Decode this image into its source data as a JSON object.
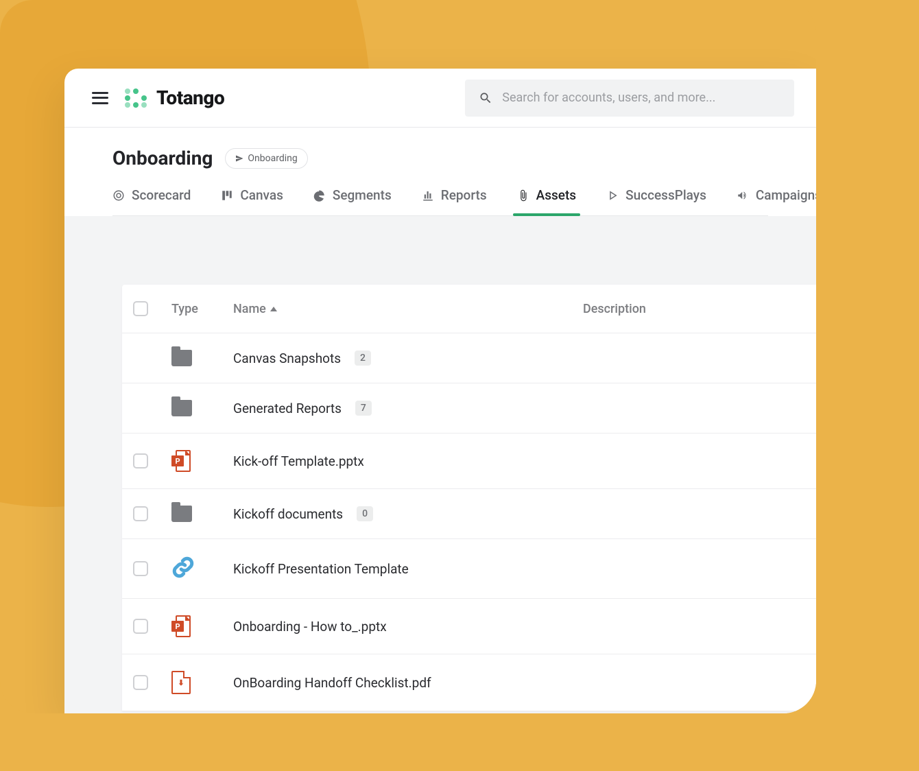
{
  "brand": {
    "name": "Totango"
  },
  "search": {
    "placeholder": "Search for accounts, users, and more..."
  },
  "page": {
    "title": "Onboarding",
    "chip": "Onboarding"
  },
  "tabs": [
    {
      "label": "Scorecard",
      "icon": "target-icon"
    },
    {
      "label": "Canvas",
      "icon": "kanban-icon"
    },
    {
      "label": "Segments",
      "icon": "pie-icon"
    },
    {
      "label": "Reports",
      "icon": "bar-chart-icon"
    },
    {
      "label": "Assets",
      "icon": "paperclip-icon",
      "active": true
    },
    {
      "label": "SuccessPlays",
      "icon": "play-icon"
    },
    {
      "label": "Campaigns",
      "icon": "megaphone-icon"
    }
  ],
  "table": {
    "columns": {
      "type": "Type",
      "name": "Name",
      "description": "Description"
    },
    "rows": [
      {
        "type": "folder",
        "name": "Canvas Snapshots",
        "count": "2",
        "checkbox": false
      },
      {
        "type": "folder",
        "name": "Generated Reports",
        "count": "7",
        "checkbox": false
      },
      {
        "type": "ppt",
        "name": "Kick-off Template.pptx",
        "checkbox": true
      },
      {
        "type": "folder",
        "name": "Kickoff documents",
        "count": "0",
        "checkbox": true
      },
      {
        "type": "link",
        "name": "Kickoff Presentation Template",
        "checkbox": true
      },
      {
        "type": "ppt",
        "name": "Onboarding - How to_.pptx",
        "checkbox": true
      },
      {
        "type": "pdf",
        "name": "OnBoarding Handoff Checklist.pdf",
        "checkbox": true
      }
    ]
  }
}
